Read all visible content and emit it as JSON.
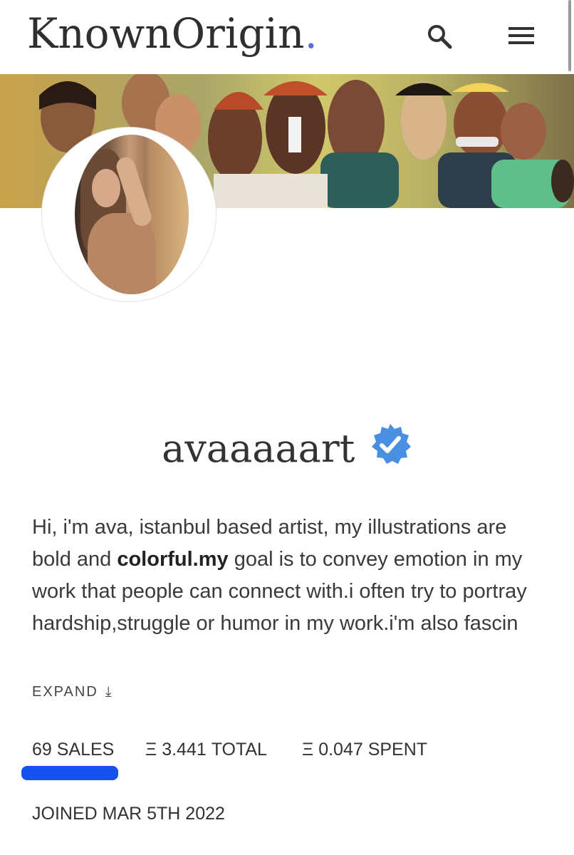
{
  "header": {
    "logo_text": "KnownOrigin",
    "logo_dot": ".",
    "logo_dot_color": "#5a6fd8",
    "search_icon": "search-icon",
    "menu_icon": "hamburger-menu-icon"
  },
  "profile": {
    "username": "avaaaaart",
    "verified_icon": "verified-badge-icon",
    "verified_color": "#4a90e2",
    "bio_part1": "Hi, i'm ava, istanbul based artist, my illustrations are bold and ",
    "bio_bold": "colorful.my",
    "bio_part2": " goal is to convey emotion in my work that people can connect with.i often try to portray hardship,struggle or humor in my work.i'm also fascin",
    "expand_label": "EXPAND",
    "expand_icon": "arrow-down-to-line-icon"
  },
  "stats": {
    "sales": "69 SALES",
    "total": "Ξ 3.441 TOTAL",
    "spent": "Ξ 0.047 SPENT",
    "highlight_color": "#1552ef"
  },
  "joined": "JOINED MAR 5TH 2022"
}
